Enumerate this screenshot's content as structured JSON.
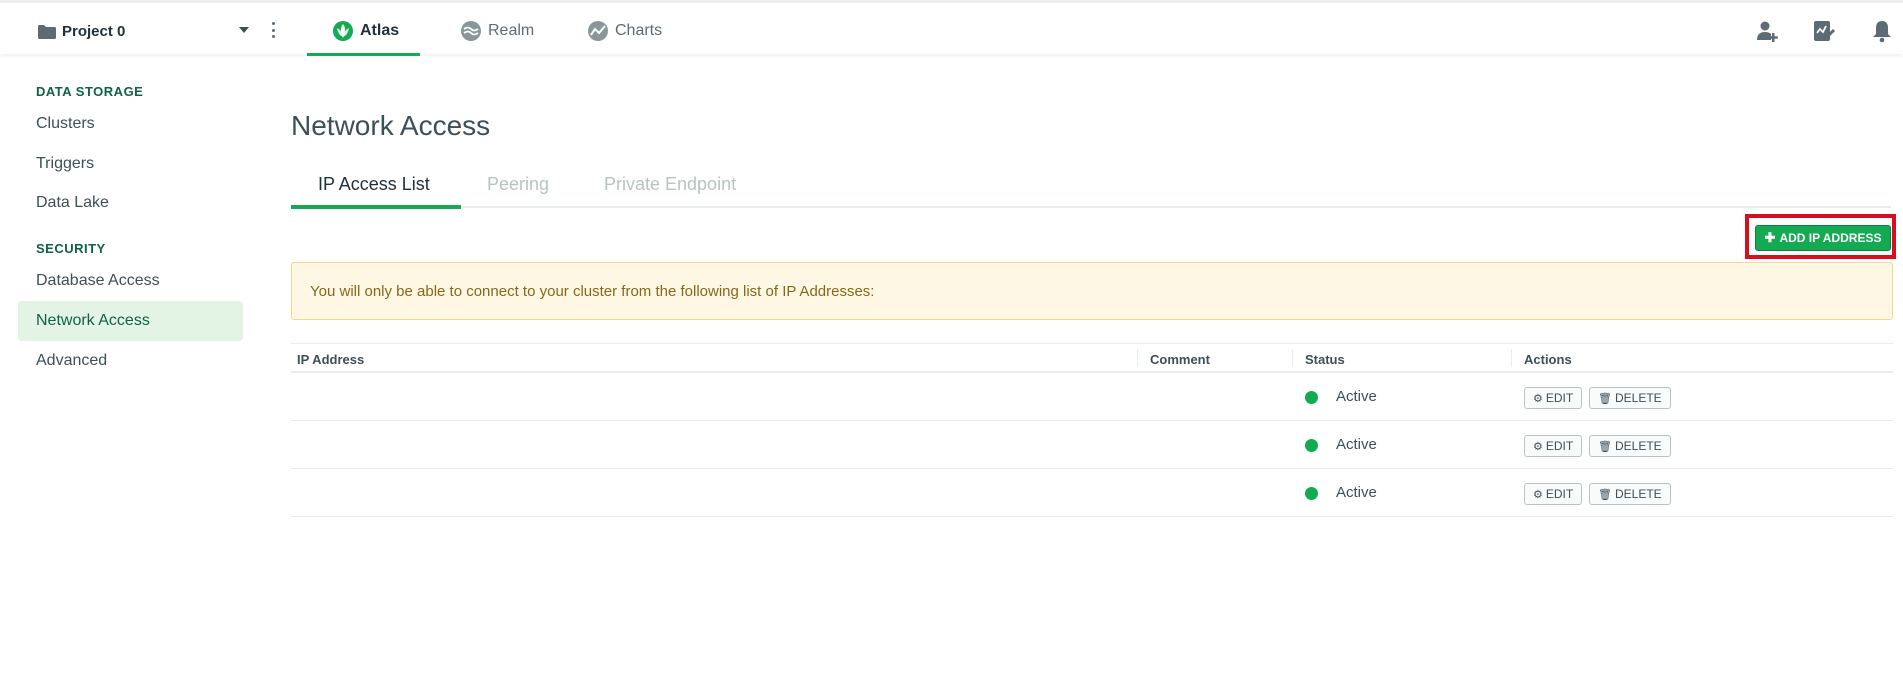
{
  "topbar": {
    "project_name": "Project 0",
    "nav_tabs": [
      {
        "label": "Atlas",
        "icon": "leaf-icon",
        "active": true
      },
      {
        "label": "Realm",
        "icon": "realm-icon",
        "active": false
      },
      {
        "label": "Charts",
        "icon": "charts-icon",
        "active": false
      }
    ],
    "right_icons": [
      "invite-user-icon",
      "activity-icon",
      "bell-icon"
    ]
  },
  "sidebar": {
    "sections": [
      {
        "heading": "DATA STORAGE",
        "items": [
          "Clusters",
          "Triggers",
          "Data Lake"
        ]
      },
      {
        "heading": "SECURITY",
        "items": [
          "Database Access",
          "Network Access",
          "Advanced"
        ]
      }
    ],
    "active_item": "Network Access"
  },
  "main": {
    "title": "Network Access",
    "tabs": [
      "IP Access List",
      "Peering",
      "Private Endpoint"
    ],
    "active_tab": "IP Access List",
    "add_button": "ADD IP ADDRESS",
    "notice": "You will only be able to connect to your cluster from the following list of IP Addresses:",
    "table": {
      "columns": [
        "IP Address",
        "Comment",
        "Status",
        "Actions"
      ],
      "rows": [
        {
          "ip": "",
          "comment": "",
          "status": "Active"
        },
        {
          "ip": "",
          "comment": "",
          "status": "Active"
        },
        {
          "ip": "",
          "comment": "",
          "status": "Active"
        }
      ],
      "edit_label": "EDIT",
      "delete_label": "DELETE"
    }
  },
  "colors": {
    "accent": "#13aa52",
    "highlight": "#d3101d",
    "notice_bg": "#fef7e3",
    "sidebar_active_bg": "#e4f4e4"
  }
}
